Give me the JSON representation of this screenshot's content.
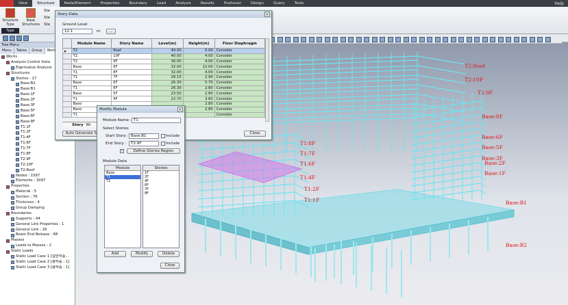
{
  "menubar": {
    "items": [
      "View",
      "Structure",
      "Node/Element",
      "Properties",
      "Boundary",
      "Load",
      "Analysis",
      "Results",
      "Pushover",
      "Design",
      "Query",
      "Tools"
    ],
    "active": "Structure",
    "help": "Help"
  },
  "ribbon": {
    "structure_type": "Structure Type",
    "base_structures": "Base Structures",
    "ste1": "Ste",
    "ste2": "Ste",
    "ste3": "Ste",
    "group": "Type"
  },
  "left": {
    "title": "Tree Menu",
    "tabs": [
      "Menu",
      "Tables",
      "Group",
      "Works"
    ],
    "tree": [
      {
        "t": "Works",
        "d": 0
      },
      {
        "t": "Analysis Control Data",
        "d": 1
      },
      {
        "t": "Eigenvalue Analysis",
        "d": 2
      },
      {
        "t": "Structures",
        "d": 1
      },
      {
        "t": "Stories : 17",
        "d": 2
      },
      {
        "t": "Base:B2",
        "d": 3
      },
      {
        "t": "Base:B1",
        "d": 3
      },
      {
        "t": "Base:1F",
        "d": 3
      },
      {
        "t": "Base:2F",
        "d": 3
      },
      {
        "t": "Base:3F",
        "d": 3
      },
      {
        "t": "Base:5F",
        "d": 3
      },
      {
        "t": "Base:6F",
        "d": 3
      },
      {
        "t": "Base:8F",
        "d": 3
      },
      {
        "t": "T1:1F",
        "d": 3
      },
      {
        "t": "T1:2F",
        "d": 3
      },
      {
        "t": "T1:4F",
        "d": 3
      },
      {
        "t": "T1:6F",
        "d": 3
      },
      {
        "t": "T1:7F",
        "d": 3
      },
      {
        "t": "T1:8F",
        "d": 3
      },
      {
        "t": "T2:9F",
        "d": 3
      },
      {
        "t": "T2:10F",
        "d": 3
      },
      {
        "t": "T2:Roof",
        "d": 3
      },
      {
        "t": "Nodes : 1587",
        "d": 2
      },
      {
        "t": "Elements : 3097",
        "d": 2
      },
      {
        "t": "Properties",
        "d": 1
      },
      {
        "t": "Material : 5",
        "d": 2
      },
      {
        "t": "Section : 76",
        "d": 2
      },
      {
        "t": "Thickness : 4",
        "d": 2
      },
      {
        "t": "Group Damping",
        "d": 2
      },
      {
        "t": "Boundaries",
        "d": 1
      },
      {
        "t": "Supports : 44",
        "d": 2
      },
      {
        "t": "General Link Properties : 1",
        "d": 2
      },
      {
        "t": "General Link : 18",
        "d": 2
      },
      {
        "t": "Beam End Release : 68",
        "d": 2
      },
      {
        "t": "Masses",
        "d": 1
      },
      {
        "t": "Loads to Masses : 2",
        "d": 2
      },
      {
        "t": "Static Loads",
        "d": 1
      },
      {
        "t": "Static Load Case 1 [일반하중...",
        "d": 2
      },
      {
        "t": "Static Load Case 2 [활하중 : 1]",
        "d": 2
      },
      {
        "t": "Static Load Case 3 [풍하중 : 1]",
        "d": 2
      }
    ]
  },
  "story_dialog": {
    "title": "Story Data",
    "ground_level_label": "Ground Level",
    "ground_level_value": "12.1",
    "ground_level_unit": "m",
    "browse": "...",
    "headers": [
      "Module Name",
      "Story Name",
      "Level(m)",
      "Height(m)",
      "Floor Diaphragm"
    ],
    "rows": [
      [
        "T2",
        "Roof",
        "44.00",
        "0.00",
        "Consider"
      ],
      [
        "T2",
        "10F",
        "40.00",
        "4.00",
        "Consider"
      ],
      [
        "T2",
        "9F",
        "36.00",
        "4.00",
        "Consider"
      ],
      [
        "Base",
        "8F",
        "32.00",
        "12.00",
        "Consider"
      ],
      [
        "T1",
        "8F",
        "32.00",
        "4.00",
        "Consider"
      ],
      [
        "T1",
        "7F",
        "29.10",
        "2.90",
        "Consider"
      ],
      [
        "Base",
        "6F",
        "26.30",
        "5.70",
        "Consider"
      ],
      [
        "T1",
        "6F",
        "26.30",
        "2.80",
        "Consider"
      ],
      [
        "Base",
        "5F",
        "23.50",
        "2.80",
        "Consider"
      ],
      [
        "T1",
        "4F",
        "22.70",
        "3.60",
        "Consider"
      ],
      [
        "Base",
        "",
        "",
        "2.80",
        "Consider"
      ],
      [
        "Base",
        "",
        "",
        "2.80",
        "Consider"
      ],
      [
        "T1",
        "",
        "",
        "",
        "Consider"
      ]
    ],
    "sheet_tab": "Story",
    "sheet_tab2": "Wi",
    "auto_generate": "Auto Generate Sto",
    "close": "Close"
  },
  "module_dialog": {
    "title": "Modify Module",
    "module_name_label": "Module Name :",
    "module_name_value": "T1",
    "select_stories": "Select Stories",
    "start_label": "Start Story :",
    "start_value": "Base:B1",
    "end_label": "End Story :",
    "end_value": "T2:9F",
    "include": "Include",
    "define_region": "Define Stories Region",
    "module_data": "Module Data",
    "module_col": "Module",
    "stories_col": "Stories",
    "modules": [
      "Base",
      "T1",
      "T2"
    ],
    "stories": [
      "1F",
      "2F",
      "4F",
      "6F",
      "7F",
      "8F"
    ],
    "add": "Add",
    "modify": "Modify",
    "delete": "Delete",
    "close": "Close"
  },
  "floor_labels": [
    {
      "t": "T2:Roof"
    },
    {
      "t": "T2:10F"
    },
    {
      "t": "T2:9F"
    },
    {
      "t": "Base:8F"
    },
    {
      "t": "Base:6F"
    },
    {
      "t": "Base:5F"
    },
    {
      "t": "Base:3F"
    },
    {
      "t": "Base:2F"
    },
    {
      "t": "Base:1F"
    },
    {
      "t": "Base:B1"
    },
    {
      "t": "Base:B2"
    },
    {
      "t": "T1:8F"
    },
    {
      "t": "T1:7F"
    },
    {
      "t": "T1:6F"
    },
    {
      "t": "T1:4F"
    },
    {
      "t": "T1:2F"
    },
    {
      "t": "T1:1F"
    }
  ],
  "colors": {
    "label": "#e01515",
    "frame": "#6fe3f0",
    "highlight": "#d178e8",
    "row_selected": "#b8cfee",
    "row_green": "#c7e6c2"
  }
}
